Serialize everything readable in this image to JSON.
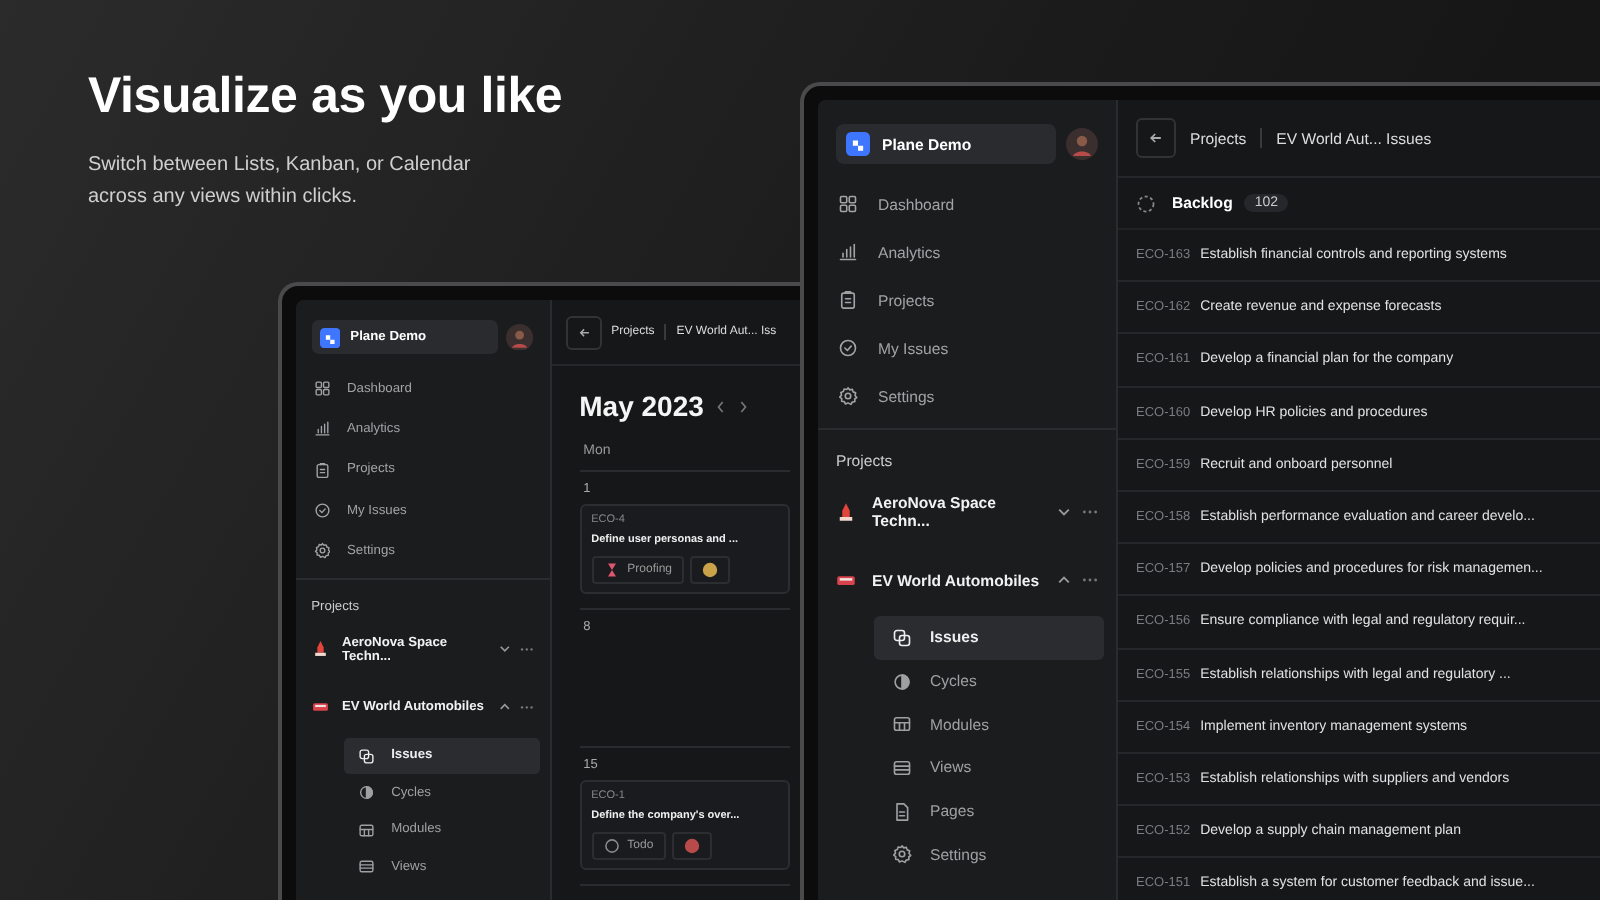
{
  "headline": {
    "title": "Visualize as you like",
    "subtitle": "Switch between Lists, Kanban, or Calendar across any views within clicks."
  },
  "windows": [
    {
      "kind": "calendar",
      "workspace": "Plane Demo",
      "nav": [
        {
          "label": "Dashboard"
        },
        {
          "label": "Analytics"
        },
        {
          "label": "Projects"
        },
        {
          "label": "My Issues"
        },
        {
          "label": "Settings"
        }
      ],
      "projects_label": "Projects",
      "projects": [
        {
          "name": "AeroNova Space Techn...",
          "expanded": false
        },
        {
          "name": "EV World Automobiles",
          "expanded": true,
          "children": [
            {
              "label": "Issues",
              "selected": true
            },
            {
              "label": "Cycles",
              "selected": false
            },
            {
              "label": "Modules",
              "selected": false
            },
            {
              "label": "Views",
              "selected": false
            }
          ]
        }
      ],
      "breadcrumb": [
        "Projects",
        "EV World Aut... Iss"
      ],
      "month": "May 2023",
      "weekday": "Mon",
      "weeks": [
        {
          "day": "1",
          "issues": [
            {
              "id": "ECO-4",
              "title": "Define user personas and ...",
              "state": "Proofing",
              "kind": "proofing"
            }
          ]
        },
        {
          "day": "8"
        },
        {
          "day": "15",
          "issues": [
            {
              "id": "ECO-1",
              "title": "Define the company's over...",
              "state": "Todo",
              "kind": "todo"
            }
          ]
        }
      ]
    },
    {
      "kind": "list",
      "workspace": "Plane Demo",
      "nav": [
        {
          "label": "Dashboard"
        },
        {
          "label": "Analytics"
        },
        {
          "label": "Projects"
        },
        {
          "label": "My Issues"
        },
        {
          "label": "Settings"
        }
      ],
      "projects_label": "Projects",
      "projects": [
        {
          "name": "AeroNova Space Techn...",
          "expanded": false
        },
        {
          "name": "EV World Automobiles",
          "expanded": true,
          "children": [
            {
              "label": "Issues",
              "selected": true
            },
            {
              "label": "Cycles",
              "selected": false
            },
            {
              "label": "Modules",
              "selected": false
            },
            {
              "label": "Views",
              "selected": false
            },
            {
              "label": "Pages",
              "selected": false
            },
            {
              "label": "Settings",
              "selected": false
            }
          ]
        }
      ],
      "breadcrumb": [
        "Projects",
        "EV World Aut... Issues"
      ],
      "group": {
        "name": "Backlog",
        "count": "102"
      },
      "issues": [
        {
          "id": "ECO-163",
          "title": "Establish financial controls and reporting systems"
        },
        {
          "id": "ECO-162",
          "title": "Create revenue and expense forecasts"
        },
        {
          "id": "ECO-161",
          "title": "Develop a financial plan for the company"
        },
        {
          "id": "ECO-160",
          "title": "Develop HR policies and procedures"
        },
        {
          "id": "ECO-159",
          "title": "Recruit and onboard personnel"
        },
        {
          "id": "ECO-158",
          "title": "Establish performance evaluation and career develo..."
        },
        {
          "id": "ECO-157",
          "title": "Develop policies and procedures for risk managemen..."
        },
        {
          "id": "ECO-156",
          "title": "Ensure compliance with legal and regulatory requir..."
        },
        {
          "id": "ECO-155",
          "title": "Establish relationships with legal and regulatory ..."
        },
        {
          "id": "ECO-154",
          "title": "Implement inventory management systems"
        },
        {
          "id": "ECO-153",
          "title": "Establish relationships with suppliers and vendors"
        },
        {
          "id": "ECO-152",
          "title": "Develop a supply chain management plan"
        },
        {
          "id": "ECO-151",
          "title": "Establish a system for customer feedback and issue..."
        }
      ]
    }
  ]
}
